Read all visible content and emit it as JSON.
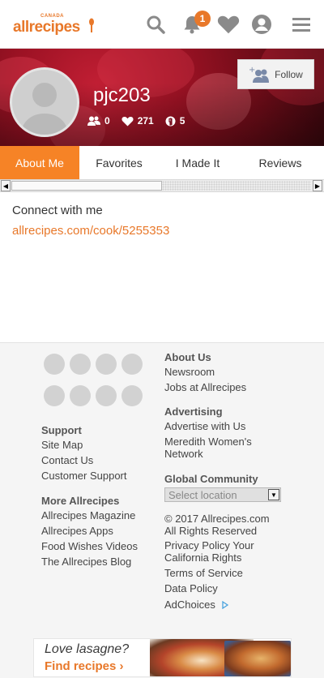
{
  "header": {
    "logo_country": "CANADA",
    "logo_text": "allrecipes",
    "notification_count": "1",
    "icons": [
      "search-icon",
      "bell-icon",
      "heart-icon",
      "user-icon",
      "menu-icon"
    ]
  },
  "profile": {
    "username": "pjc203",
    "follow_label": "Follow",
    "followers": "0",
    "favorites": "271",
    "made_it": "5"
  },
  "tabs": [
    {
      "label": "About Me",
      "active": true
    },
    {
      "label": "Favorites",
      "active": false
    },
    {
      "label": "I Made It",
      "active": false
    },
    {
      "label": "Reviews",
      "active": false
    }
  ],
  "about": {
    "connect_heading": "Connect with me",
    "link": "allrecipes.com/cook/5255353"
  },
  "footer": {
    "about_us": {
      "heading": "About Us",
      "links": [
        "Newsroom",
        "Jobs at Allrecipes"
      ]
    },
    "advertising": {
      "heading": "Advertising",
      "links": [
        "Advertise with Us",
        "Meredith Women's",
        "Network"
      ]
    },
    "global": {
      "heading": "Global Community",
      "select_placeholder": "Select location"
    },
    "support": {
      "heading": "Support",
      "links": [
        "Site Map",
        "Contact Us",
        "Customer Support"
      ]
    },
    "more": {
      "heading": "More Allrecipes",
      "links": [
        "Allrecipes Magazine",
        "Allrecipes Apps",
        "Food Wishes Videos",
        "The Allrecipes Blog"
      ]
    },
    "legal": [
      "© 2017 Allrecipes.com",
      "All Rights Reserved",
      "Privacy Policy Your",
      "California Rights",
      "Terms of Service",
      "Data Policy",
      "AdChoices"
    ]
  },
  "ad": {
    "line1": "Love lasagne?",
    "line2": "Find recipes ›"
  },
  "colors": {
    "accent": "#f68326",
    "brand_orange": "#e8782a",
    "hero_red": "#9d1224"
  }
}
